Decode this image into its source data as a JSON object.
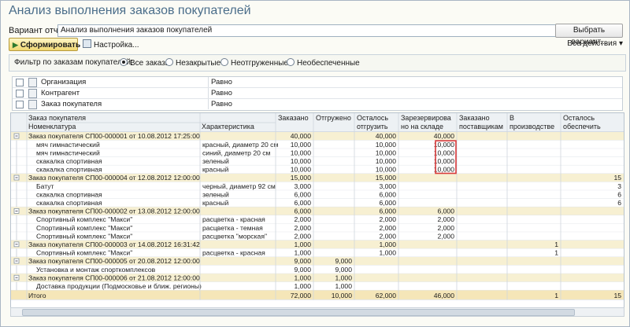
{
  "window": {
    "title": "Анализ выполнения заказов покупателей"
  },
  "variant": {
    "label": "Вариант отчета:",
    "value": "Анализ выполнения заказов покупателей",
    "button": "Выбрать вариант..."
  },
  "toolbar": {
    "form_button": "Сформировать",
    "settings_button": "Настройка...",
    "all_actions": "Все действия"
  },
  "filter": {
    "label": "Фильтр по заказам покупателей:",
    "options": [
      "Все заказы",
      "Незакрытые",
      "Неотгруженные",
      "Необеспеченные"
    ],
    "selected": "Все заказы"
  },
  "params": [
    {
      "name": "Организация",
      "condition": "Равно"
    },
    {
      "name": "Контрагент",
      "condition": "Равно"
    },
    {
      "name": "Заказ покупателя",
      "condition": "Равно"
    }
  ],
  "report": {
    "columns": {
      "order_header": "Заказ покупателя",
      "item": "Номенклатура",
      "characteristic": "Характеристика",
      "ordered": "Заказано",
      "shipped": "Отгружено",
      "remaining_1": "Осталось",
      "remaining_2": "отгрузить",
      "reserved_1": "Зарезервирова",
      "reserved_2": "но на складе",
      "supplier_1": "Заказано",
      "supplier_2": "поставщикам",
      "production_1": "В",
      "production_2": "производстве",
      "provide_1": "Осталось",
      "provide_2": "обеспечить"
    },
    "rows": [
      {
        "kind": "group",
        "name": "Заказ покупателя СП00-000001 от 10.08.2012 17:25:00",
        "ordered": "40,000",
        "shipped": "",
        "remaining": "40,000",
        "reserved": "40,000",
        "supplier": "",
        "production": "",
        "provide": ""
      },
      {
        "kind": "item",
        "name": "мяч гимнастический",
        "characteristic": "красный, диаметр 20 см",
        "ordered": "10,000",
        "shipped": "",
        "remaining": "10,000",
        "reserved": "10,000",
        "supplier": "",
        "production": "",
        "provide": ""
      },
      {
        "kind": "item",
        "name": "мяч гимнастический",
        "characteristic": "синий, диаметр 20 см",
        "ordered": "10,000",
        "shipped": "",
        "remaining": "10,000",
        "reserved": "10,000",
        "supplier": "",
        "production": "",
        "provide": ""
      },
      {
        "kind": "item",
        "name": "скакалка спортивная",
        "characteristic": "зеленый",
        "ordered": "10,000",
        "shipped": "",
        "remaining": "10,000",
        "reserved": "10,000",
        "supplier": "",
        "production": "",
        "provide": ""
      },
      {
        "kind": "item",
        "name": "скакалка спортивная",
        "characteristic": "красный",
        "ordered": "10,000",
        "shipped": "",
        "remaining": "10,000",
        "reserved": "10,000",
        "supplier": "",
        "production": "",
        "provide": ""
      },
      {
        "kind": "group",
        "name": "Заказ покупателя СП00-000004 от 12.08.2012 12:00:00",
        "ordered": "15,000",
        "shipped": "",
        "remaining": "15,000",
        "reserved": "",
        "supplier": "",
        "production": "",
        "provide": "15"
      },
      {
        "kind": "item",
        "name": "Батут",
        "characteristic": "черный, диаметр 92 см",
        "ordered": "3,000",
        "shipped": "",
        "remaining": "3,000",
        "reserved": "",
        "supplier": "",
        "production": "",
        "provide": "3"
      },
      {
        "kind": "item",
        "name": "скакалка спортивная",
        "characteristic": "зеленый",
        "ordered": "6,000",
        "shipped": "",
        "remaining": "6,000",
        "reserved": "",
        "supplier": "",
        "production": "",
        "provide": "6"
      },
      {
        "kind": "item",
        "name": "скакалка спортивная",
        "characteristic": "красный",
        "ordered": "6,000",
        "shipped": "",
        "remaining": "6,000",
        "reserved": "",
        "supplier": "",
        "production": "",
        "provide": "6"
      },
      {
        "kind": "group",
        "name": "Заказ покупателя СП00-000002 от 13.08.2012 12:00:00",
        "ordered": "6,000",
        "shipped": "",
        "remaining": "6,000",
        "reserved": "6,000",
        "supplier": "",
        "production": "",
        "provide": ""
      },
      {
        "kind": "item",
        "name": "Спортивный комплекс \"Макси\"",
        "characteristic": "расцветка - красная",
        "ordered": "2,000",
        "shipped": "",
        "remaining": "2,000",
        "reserved": "2,000",
        "supplier": "",
        "production": "",
        "provide": ""
      },
      {
        "kind": "item",
        "name": "Спортивный комплекс \"Макси\"",
        "characteristic": "расцветка - темная",
        "ordered": "2,000",
        "shipped": "",
        "remaining": "2,000",
        "reserved": "2,000",
        "supplier": "",
        "production": "",
        "provide": ""
      },
      {
        "kind": "item",
        "name": "Спортивный комплекс \"Макси\"",
        "characteristic": "расцветка \"морская\"",
        "ordered": "2,000",
        "shipped": "",
        "remaining": "2,000",
        "reserved": "2,000",
        "supplier": "",
        "production": "",
        "provide": ""
      },
      {
        "kind": "group",
        "name": "Заказ покупателя СП00-000003 от 14.08.2012 16:31:42",
        "ordered": "1,000",
        "shipped": "",
        "remaining": "1,000",
        "reserved": "",
        "supplier": "",
        "production": "1",
        "provide": ""
      },
      {
        "kind": "item",
        "name": "Спортивный комплекс \"Макси\"",
        "characteristic": "расцветка - красная",
        "ordered": "1,000",
        "shipped": "",
        "remaining": "1,000",
        "reserved": "",
        "supplier": "",
        "production": "1",
        "provide": ""
      },
      {
        "kind": "group",
        "name": "Заказ покупателя СП00-000005 от 20.08.2012 12:00:00",
        "ordered": "9,000",
        "shipped": "9,000",
        "remaining": "",
        "reserved": "",
        "supplier": "",
        "production": "",
        "provide": ""
      },
      {
        "kind": "item",
        "name": "Установка и монтаж спорткомплексов",
        "characteristic": "",
        "ordered": "9,000",
        "shipped": "9,000",
        "remaining": "",
        "reserved": "",
        "supplier": "",
        "production": "",
        "provide": ""
      },
      {
        "kind": "group",
        "name": "Заказ покупателя СП00-000006 от 21.08.2012 12:00:00",
        "ordered": "1,000",
        "shipped": "1,000",
        "remaining": "",
        "reserved": "",
        "supplier": "",
        "production": "",
        "provide": ""
      },
      {
        "kind": "item",
        "name": "Доставка продукции (Подмосковье и ближ. регионы)",
        "characteristic": "",
        "ordered": "1,000",
        "shipped": "1,000",
        "remaining": "",
        "reserved": "",
        "supplier": "",
        "production": "",
        "provide": ""
      }
    ],
    "total": {
      "name": "Итого",
      "ordered": "72,000",
      "shipped": "10,000",
      "remaining": "62,000",
      "reserved": "46,000",
      "supplier": "",
      "production": "1",
      "provide": "15"
    }
  },
  "colors": {
    "group_bg": "#f7f0d2",
    "header_bg": "#edf1f4",
    "total_bg": "#f5e6b8",
    "highlight": "#d83a3a"
  }
}
